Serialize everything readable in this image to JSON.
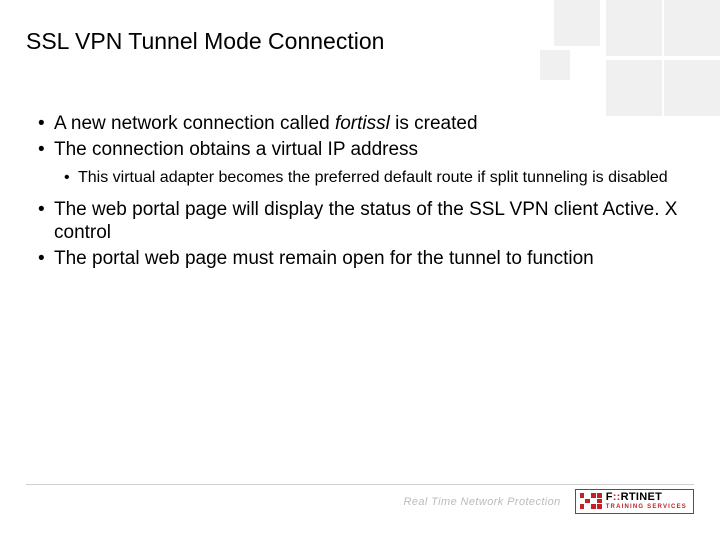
{
  "slide": {
    "title": "SSL VPN Tunnel Mode Connection"
  },
  "bullets": {
    "b1_pre": "A new network connection called ",
    "b1_italic": "fortissl",
    "b1_post": " is created",
    "b2": "The connection obtains a virtual IP address",
    "b2_1": "This virtual adapter becomes the preferred default route if split tunneling is disabled",
    "b3": "The web portal page will display the status of the SSL VPN client Active. X control",
    "b4": "The portal web page must remain open for the tunnel to function"
  },
  "footer": {
    "tagline": "Real Time Network Protection",
    "logo_text_1": "F",
    "logo_text_2": "RTINET",
    "logo_sub": "TRAINING SERVICES"
  },
  "colors": {
    "accent": "#c42026"
  }
}
